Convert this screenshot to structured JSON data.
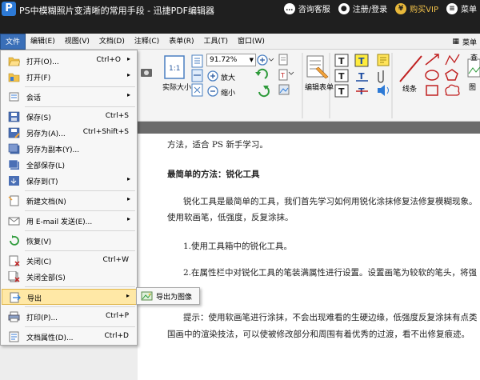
{
  "window": {
    "title": "PS中模糊照片变清晰的常用手段 - 迅捷PDF编辑器",
    "logo_letter": "P",
    "consult": "咨询客服",
    "login": "注册/登录",
    "vip": "购买VIP",
    "menu": "菜单"
  },
  "menubar": {
    "items": [
      "文件",
      "编辑(E)",
      "视图(V)",
      "文档(D)",
      "注释(C)",
      "表单(R)",
      "工具(T)",
      "窗口(W)"
    ],
    "right_label": "菜单"
  },
  "toolbar": {
    "zoom_value": "91.72%",
    "actual_size": "实际大小",
    "zoom_in": "放大",
    "zoom_out": "缩小",
    "edit_form": "编辑表单",
    "line": "线条",
    "image": "图",
    "search": "查"
  },
  "file_menu": {
    "items": [
      {
        "label": "打开(O)...",
        "shortcut": "Ctrl+O",
        "arrow": "▸",
        "icon": "folder-open-icon"
      },
      {
        "label": "打开(F)",
        "shortcut": "",
        "arrow": "▸",
        "icon": "folder-icon"
      },
      {
        "label": "会话",
        "shortcut": "",
        "arrow": "▸",
        "icon": "session-icon"
      },
      {
        "label": "保存(S)",
        "shortcut": "Ctrl+S",
        "arrow": "",
        "icon": "save-icon"
      },
      {
        "label": "另存为(A)...",
        "shortcut": "Ctrl+Shift+S",
        "arrow": "",
        "icon": "save-as-icon"
      },
      {
        "label": "另存为副本(Y)...",
        "shortcut": "",
        "arrow": "",
        "icon": "save-copy-icon"
      },
      {
        "label": "全部保存(L)",
        "shortcut": "",
        "arrow": "",
        "icon": "save-all-icon"
      },
      {
        "label": "保存到(T)",
        "shortcut": "",
        "arrow": "▸",
        "icon": "save-to-icon"
      },
      {
        "label": "新建文档(N)",
        "shortcut": "",
        "arrow": "▸",
        "icon": "new-document-icon"
      },
      {
        "label": "用 E-mail 发送(E)...",
        "shortcut": "",
        "arrow": "▸",
        "icon": "email-icon"
      },
      {
        "label": "恢复(V)",
        "shortcut": "",
        "arrow": "",
        "icon": "restore-icon"
      },
      {
        "label": "关闭(C)",
        "shortcut": "Ctrl+W",
        "arrow": "",
        "icon": "close-document-icon"
      },
      {
        "label": "关闭全部(S)",
        "shortcut": "",
        "arrow": "",
        "icon": "close-all-icon"
      },
      {
        "label": "导出",
        "shortcut": "",
        "arrow": "▸",
        "icon": "export-icon"
      },
      {
        "label": "打印(P)...",
        "shortcut": "Ctrl+P",
        "arrow": "",
        "icon": "print-icon"
      },
      {
        "label": "文档属性(D)...",
        "shortcut": "Ctrl+D",
        "arrow": "",
        "icon": "document-properties-icon"
      }
    ]
  },
  "export_submenu": {
    "label": "导出为图像"
  },
  "document": {
    "line1": "方法，适合 PS 新手学习。",
    "heading": "最简单的方法：锐化工具",
    "para1a": "锐化工具是最简单的工具，我们首先学习如何用锐化涂抹修复法修复模糊现象。",
    "para1b": "使用软画笔，低强度，反复涂抹。",
    "step1": "1.使用工具箱中的锐化工具。",
    "step2": "2.在属性栏中对锐化工具的笔装满属性进行设置。设置画笔为较软的笔头，将强",
    "tip1": "提示：使用软画笔进行涂抹，不会出现难看的生硬边缘，低强度反复涂抹有点类",
    "tip2": "国画中的渲染技法，可以使被修改部分和周围有着优秀的过渡，看不出修复痕迹。"
  },
  "colors": {
    "accent": "#3a6fb8",
    "highlight": "#ffe8a6",
    "titlebar": "#1f1f1f"
  }
}
